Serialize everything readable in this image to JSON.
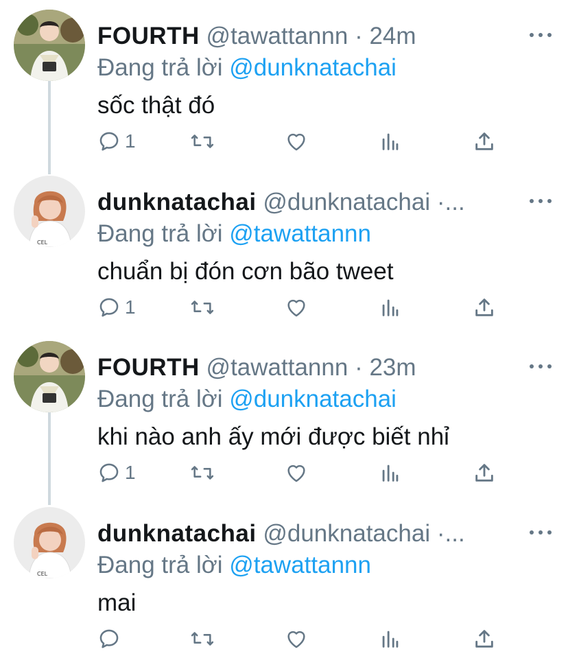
{
  "tweets": [
    {
      "name": "FOURTH",
      "handle": "@tawattannn",
      "separator": "·",
      "time": "24m",
      "reply_prefix": "Đang trả lời",
      "reply_to": "@dunknatachai",
      "text": "sốc thật đó",
      "reply_count": "1",
      "avatar": "fourth-avatar"
    },
    {
      "name": "dunknatachai",
      "handle": "@dunknatachai",
      "separator": "·...",
      "time": "",
      "reply_prefix": "Đang trả lời",
      "reply_to": "@tawattannn",
      "text": "chuẩn bị đón cơn bão tweet",
      "reply_count": "1",
      "avatar": "dunk-avatar"
    },
    {
      "name": "FOURTH",
      "handle": "@tawattannn",
      "separator": "·",
      "time": "23m",
      "reply_prefix": "Đang trả lời",
      "reply_to": "@dunknatachai",
      "text": "khi nào anh ấy mới được biết nhỉ",
      "reply_count": "1",
      "avatar": "fourth-avatar"
    },
    {
      "name": "dunknatachai",
      "handle": "@dunknatachai",
      "separator": "·...",
      "time": "",
      "reply_prefix": "Đang trả lời",
      "reply_to": "@tawattannn",
      "text": "mai",
      "reply_count": "",
      "avatar": "dunk-avatar"
    }
  ],
  "colors": {
    "text": "#14171a",
    "secondary": "#657786",
    "mention": "#1da1f2",
    "thread_line": "#cfd9de"
  },
  "icons": [
    "reply-icon",
    "retweet-icon",
    "like-icon",
    "analytics-icon",
    "share-icon",
    "more-icon"
  ]
}
